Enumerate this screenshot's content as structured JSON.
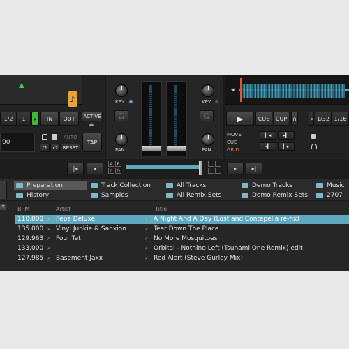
{
  "colors": {
    "accent": "#5fa8bd",
    "orange": "#e8a040",
    "active_green": "#3cd23c",
    "grid_orange": "#e08a2c"
  },
  "deck_left": {
    "loop_sizes": [
      "1/2",
      "1"
    ],
    "in_label": "IN",
    "out_label": "OUT",
    "active_label": "ACTIVE",
    "auto_label": "AUTO",
    "half_label": "/2",
    "x2_label": "x2",
    "reset_label": "RESET",
    "tap_label": "TAP",
    "tempo_value": "00",
    "note_icon": "music-note-icon"
  },
  "mixer": {
    "key_label": "KEY",
    "pan_label": "PAN",
    "channel_a": "A",
    "channel_b": "B",
    "channel_c": "C",
    "channel_d": "D"
  },
  "deck_right": {
    "cue_label": "CUE",
    "cup_label": "CUP",
    "loop_sizes": [
      "1/32",
      "1/16"
    ],
    "move_label": "MOVE",
    "cue_mode_label": "CUE",
    "grid_label": "GRID"
  },
  "browser": {
    "tree_items": [
      {
        "label": "Preparation",
        "icon": "folder-icon"
      },
      {
        "label": "Track Collection",
        "icon": "folder-icon"
      },
      {
        "label": "All Tracks",
        "icon": "folder-icon"
      },
      {
        "label": "Demo Tracks",
        "icon": "playlist-icon"
      },
      {
        "label": "Music",
        "icon": "folder-icon"
      },
      {
        "label": "History",
        "icon": "folder-icon"
      },
      {
        "label": "Samples",
        "icon": "folder-icon"
      },
      {
        "label": "All Remix Sets",
        "icon": "folder-icon"
      },
      {
        "label": "Demo Remix Sets",
        "icon": "playlist-icon"
      },
      {
        "label": "2707",
        "icon": "playlist-icon"
      }
    ],
    "columns": {
      "bpm": "BPM",
      "artist": "Artist",
      "title": "Title"
    },
    "tracks": [
      {
        "bpm": "110.000",
        "artist": "Pepe Deluxé",
        "title": "A Night And A Day (Lost and Contepella re-fix)"
      },
      {
        "bpm": "135.000",
        "artist": "Vinyl Junkie & Sanxion",
        "title": "Tear Down The Place"
      },
      {
        "bpm": "129.963",
        "artist": "Four Tet",
        "title": "No More Mosquitoes"
      },
      {
        "bpm": "133.000",
        "artist": "",
        "title": "Orbital - Nothing Left (Tsunami One Remix) edit"
      },
      {
        "bpm": "127.985",
        "artist": "Basement Jaxx",
        "title": "Red Alert (Steve Gurley Mix)"
      }
    ]
  }
}
